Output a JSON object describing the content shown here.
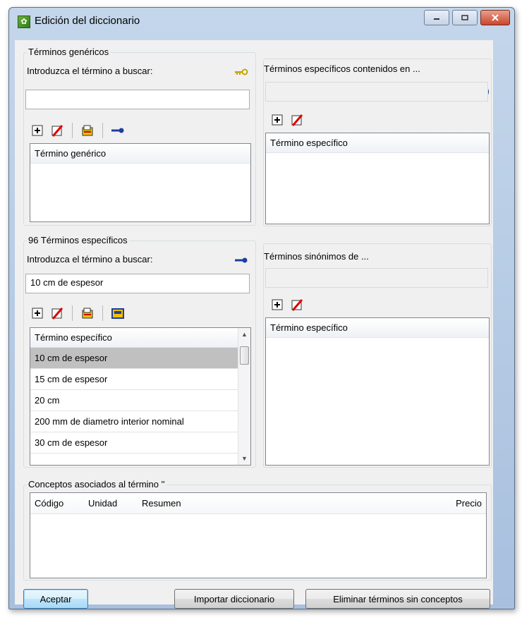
{
  "window": {
    "title": "Edición del diccionario",
    "help_glyph": "?"
  },
  "generic": {
    "group_title": "Términos genéricos",
    "search_label": "Introduzca el término a buscar:",
    "search_value": "",
    "list_header": "Término genérico"
  },
  "specific_contained": {
    "title": "Términos específicos contenidos en ...",
    "field_value": "",
    "list_header": "Término específico"
  },
  "specific": {
    "group_title": "96 Términos específicos",
    "search_label": "Introduzca el término a buscar:",
    "search_value": "10 cm de espesor",
    "list_header": "Término específico",
    "items": [
      "10 cm de espesor",
      "15 cm de espesor",
      "20 cm",
      "200 mm de diametro interior nominal",
      "30 cm de espesor"
    ],
    "selected_index": 0
  },
  "synonyms": {
    "title": "Términos sinónimos de ...",
    "field_value": "",
    "list_header": "Término específico"
  },
  "concepts": {
    "group_title": "Conceptos asociados al término ''",
    "columns": [
      "Código",
      "Unidad",
      "Resumen",
      "Precio"
    ]
  },
  "buttons": {
    "accept": "Aceptar",
    "import": "Importar diccionario",
    "remove_unused": "Eliminar términos sin conceptos"
  },
  "colors": {
    "key_icon_gold": "#c9a400",
    "key_icon_blue": "#1f3e9e",
    "selected_row": "#c0c0c0"
  }
}
